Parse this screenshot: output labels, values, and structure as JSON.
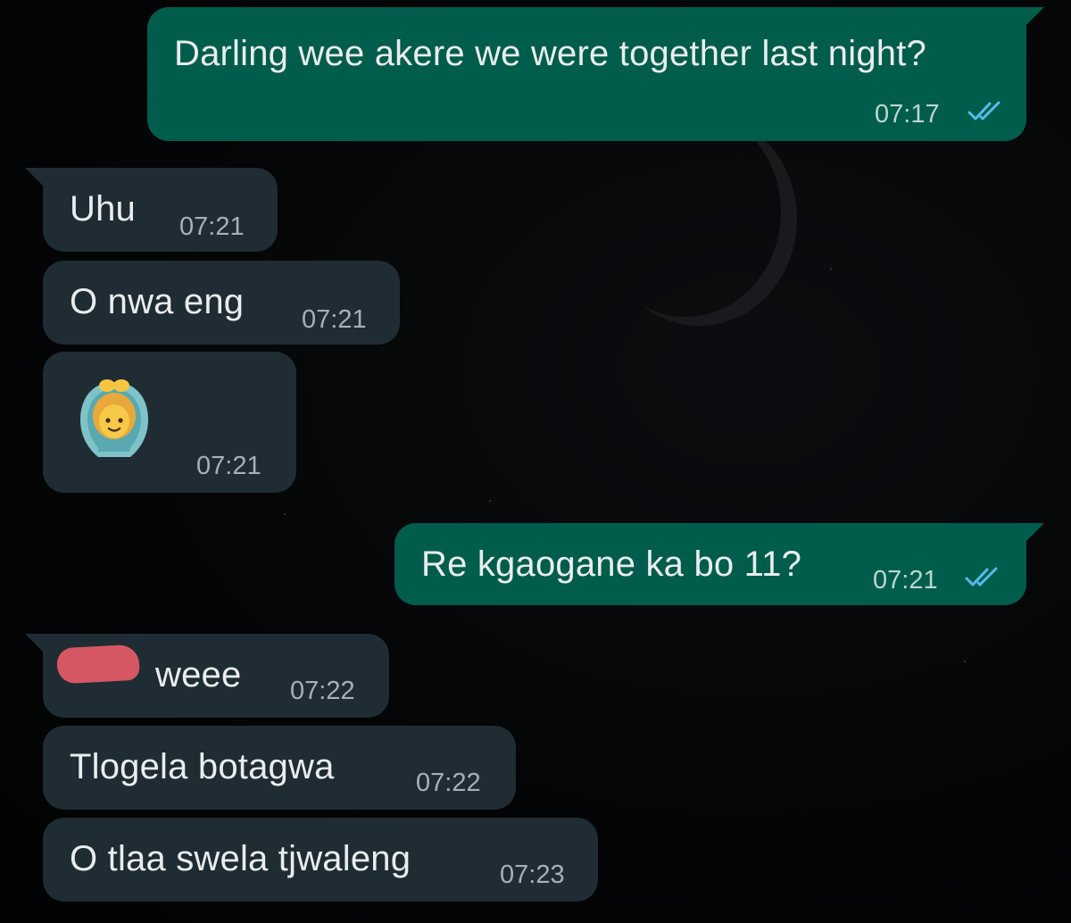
{
  "messages": [
    {
      "direction": "outgoing",
      "text": "Darling wee akere we were together last night?",
      "time": "07:17",
      "status": "read"
    },
    {
      "direction": "incoming",
      "text": "Uhu",
      "time": "07:21"
    },
    {
      "direction": "incoming",
      "text": "O nwa eng",
      "time": "07:21"
    },
    {
      "direction": "incoming",
      "emoji": "woman-gesturing-ok-icon",
      "time": "07:21"
    },
    {
      "direction": "outgoing",
      "text": "Re kgaogane ka bo 11?",
      "time": "07:21",
      "status": "read"
    },
    {
      "direction": "incoming",
      "text": "weee",
      "time": "07:22",
      "redacted_prefix": true
    },
    {
      "direction": "incoming",
      "text": "Tlogela botagwa",
      "time": "07:22"
    },
    {
      "direction": "incoming",
      "text": "O tlaa swela tjwaleng",
      "time": "07:23"
    }
  ],
  "colors": {
    "outgoing_bubble": "#005c4b",
    "incoming_bubble": "#1f2c34",
    "read_ticks": "#53bdeb",
    "redaction": "#e05a67",
    "background": "#020304"
  }
}
